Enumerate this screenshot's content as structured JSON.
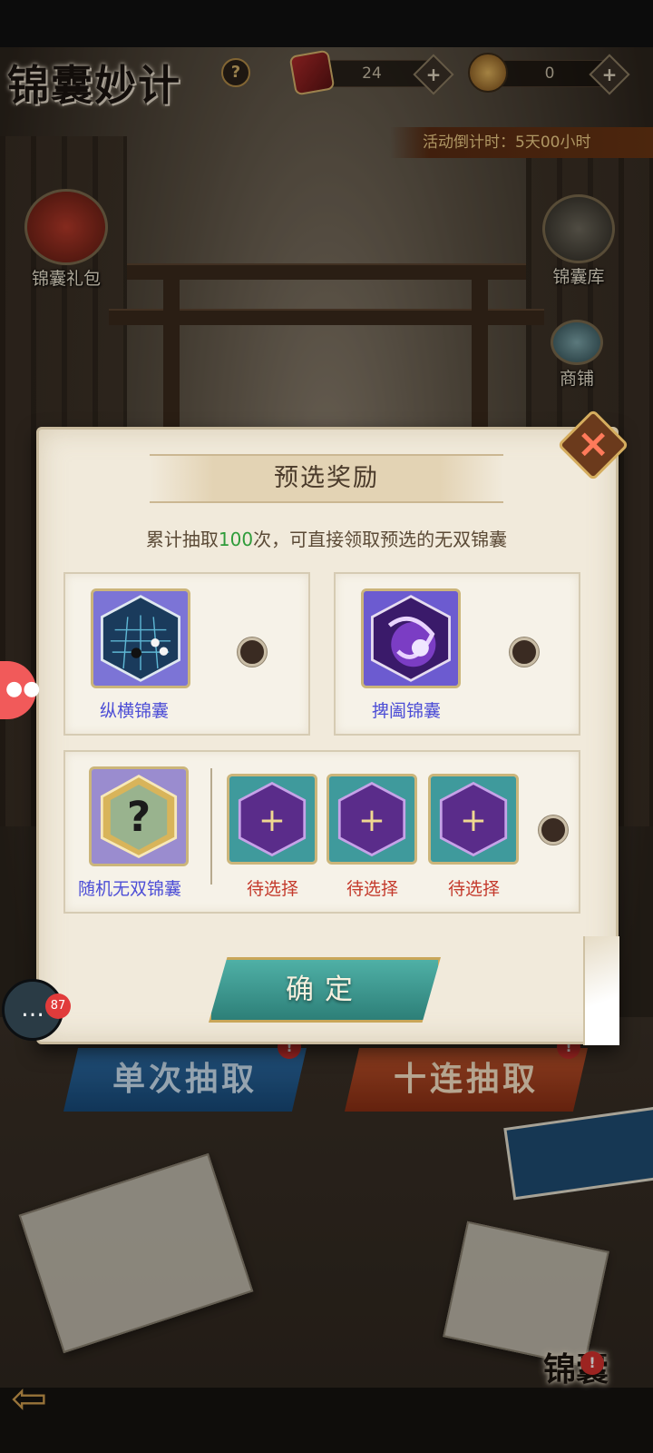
{
  "header": {
    "title": "锦囊妙计",
    "help_label": "?",
    "resource1": {
      "value": "24",
      "icon": "ticket-card-icon"
    },
    "resource2": {
      "value": "0",
      "icon": "coin-medal-icon"
    },
    "plus_label": "+",
    "countdown": "活动倒计时：5天00小时"
  },
  "side": {
    "gift_label": "锦囊礼包",
    "library_label": "锦囊库",
    "shop_label": "商铺"
  },
  "modal": {
    "title": "预选奖励",
    "desc_prefix": "累计抽取",
    "desc_count": "100",
    "desc_suffix": "次，可直接领取预选的无双锦囊",
    "close_icon": "×",
    "items": [
      {
        "name": "纵横锦囊",
        "icon": "go-board-icon"
      },
      {
        "name": "捭阖锦囊",
        "icon": "purple-swirl-icon"
      }
    ],
    "random": {
      "name": "随机无双锦囊",
      "icon": "question-mark-icon"
    },
    "pending": [
      {
        "name": "待选择",
        "icon": "add-slot-icon"
      },
      {
        "name": "待选择",
        "icon": "add-slot-icon"
      },
      {
        "name": "待选择",
        "icon": "add-slot-icon"
      }
    ],
    "confirm_label": "确定"
  },
  "actions": {
    "single_draw": "单次抽取",
    "ten_draw": "十连抽取",
    "alert": "!"
  },
  "chat": {
    "badge": "87",
    "icon": "chat-bubble-icon"
  },
  "bottom": {
    "bag_label": "锦囊",
    "back_icon": "back-arrow-icon"
  },
  "colors": {
    "accent_green": "#2f9c3a",
    "item_name": "#4c4dd6",
    "pending_name": "#c43a2c",
    "confirm_btn": "#3a958d"
  }
}
